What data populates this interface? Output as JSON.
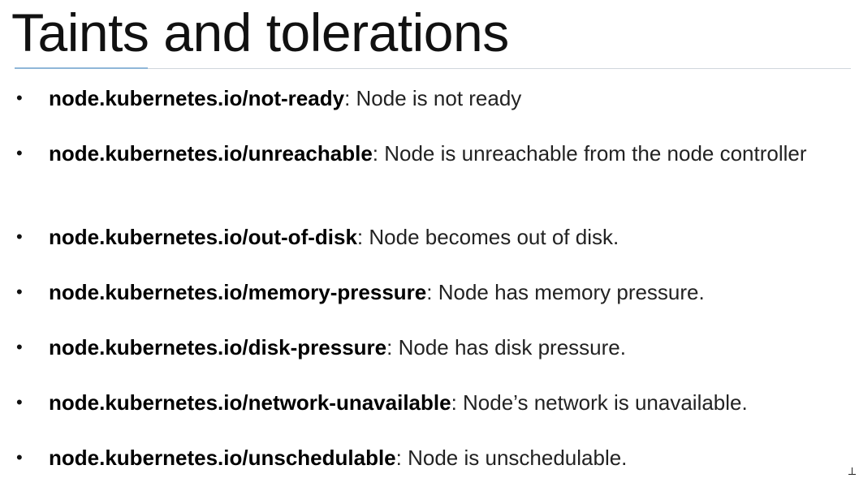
{
  "slide": {
    "title": "Taints and tolerations",
    "bullet_glyph": "•",
    "items": [
      {
        "key": "node.kubernetes.io/not-ready",
        "desc": ": Node is not ready"
      },
      {
        "key": "node.kubernetes.io/unreachable",
        "desc": ": Node is unreachable from the node controller"
      },
      {
        "key": "node.kubernetes.io/out-of-disk",
        "desc": ": Node becomes out of disk."
      },
      {
        "key": "node.kubernetes.io/memory-pressure",
        "desc": ": Node has memory pressure."
      },
      {
        "key": "node.kubernetes.io/disk-pressure",
        "desc": ": Node has disk pressure."
      },
      {
        "key": "node.kubernetes.io/network-unavailable",
        "desc": ": Node’s network is unavailable."
      },
      {
        "key": "node.kubernetes.io/unschedulable",
        "desc": ": Node is unschedulable."
      }
    ]
  },
  "colors": {
    "title": "#111111",
    "text": "#222222",
    "rule": "#d0d6dc",
    "rule_accent": "#8fb6d8",
    "background": "#ffffff"
  }
}
